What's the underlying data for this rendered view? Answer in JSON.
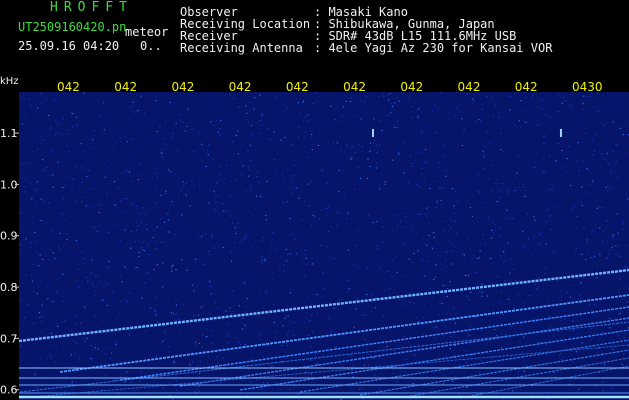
{
  "header": {
    "app_name": "HROFFT",
    "filename": "UT2509160420.pn",
    "program_tag": "meteor",
    "datetime": "25.09.16 04:20",
    "count": "0..",
    "observer_label": "Observer",
    "observer_value": ": Masaki Kano",
    "location_label": "Receiving Location",
    "location_value": ": Shibukawa, Gunma, Japan",
    "receiver_label": "Receiver",
    "receiver_value": ": SDR# 43dB L15 111.6MHz USB",
    "antenna_label": "Receiving Antenna",
    "antenna_value": ": 4ele Yagi Az 230 for Kansai VOR"
  },
  "colors": {
    "app_name": "#3ddc3d",
    "header_text": "#f0f0f0",
    "time_ticks": "#f2f200",
    "background": "#000000",
    "plot_base": "#06146a"
  },
  "chart_data": {
    "type": "heatmap",
    "y_unit": "kHz",
    "y_ticks": [
      "1.1",
      "1.0",
      "0.9",
      "0.8",
      "0.7",
      "0.6"
    ],
    "x_ticks": [
      "042",
      "042",
      "042",
      "042",
      "042",
      "042",
      "042",
      "042",
      "042",
      "0430"
    ],
    "ylim": [
      0.58,
      1.18
    ]
  }
}
